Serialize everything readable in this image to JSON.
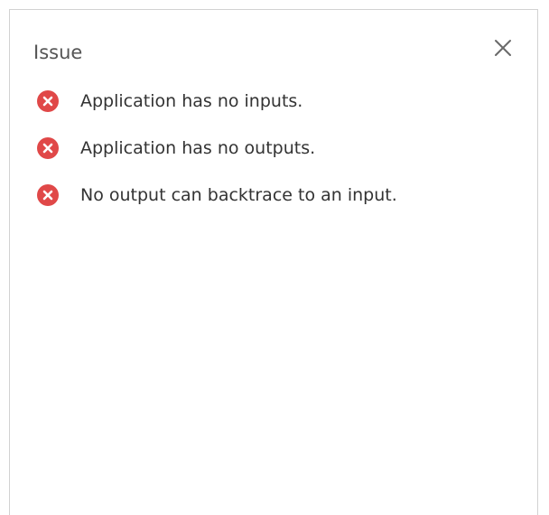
{
  "panel": {
    "title": "Issue",
    "close_icon": "close-icon"
  },
  "colors": {
    "error": "#e04848",
    "title_text": "#555555",
    "body_text": "#333333",
    "border": "#d2d2d2"
  },
  "issues": [
    {
      "icon": "error-icon",
      "text": "Application has no inputs."
    },
    {
      "icon": "error-icon",
      "text": "Application has no outputs."
    },
    {
      "icon": "error-icon",
      "text": "No output can backtrace to an input."
    }
  ]
}
